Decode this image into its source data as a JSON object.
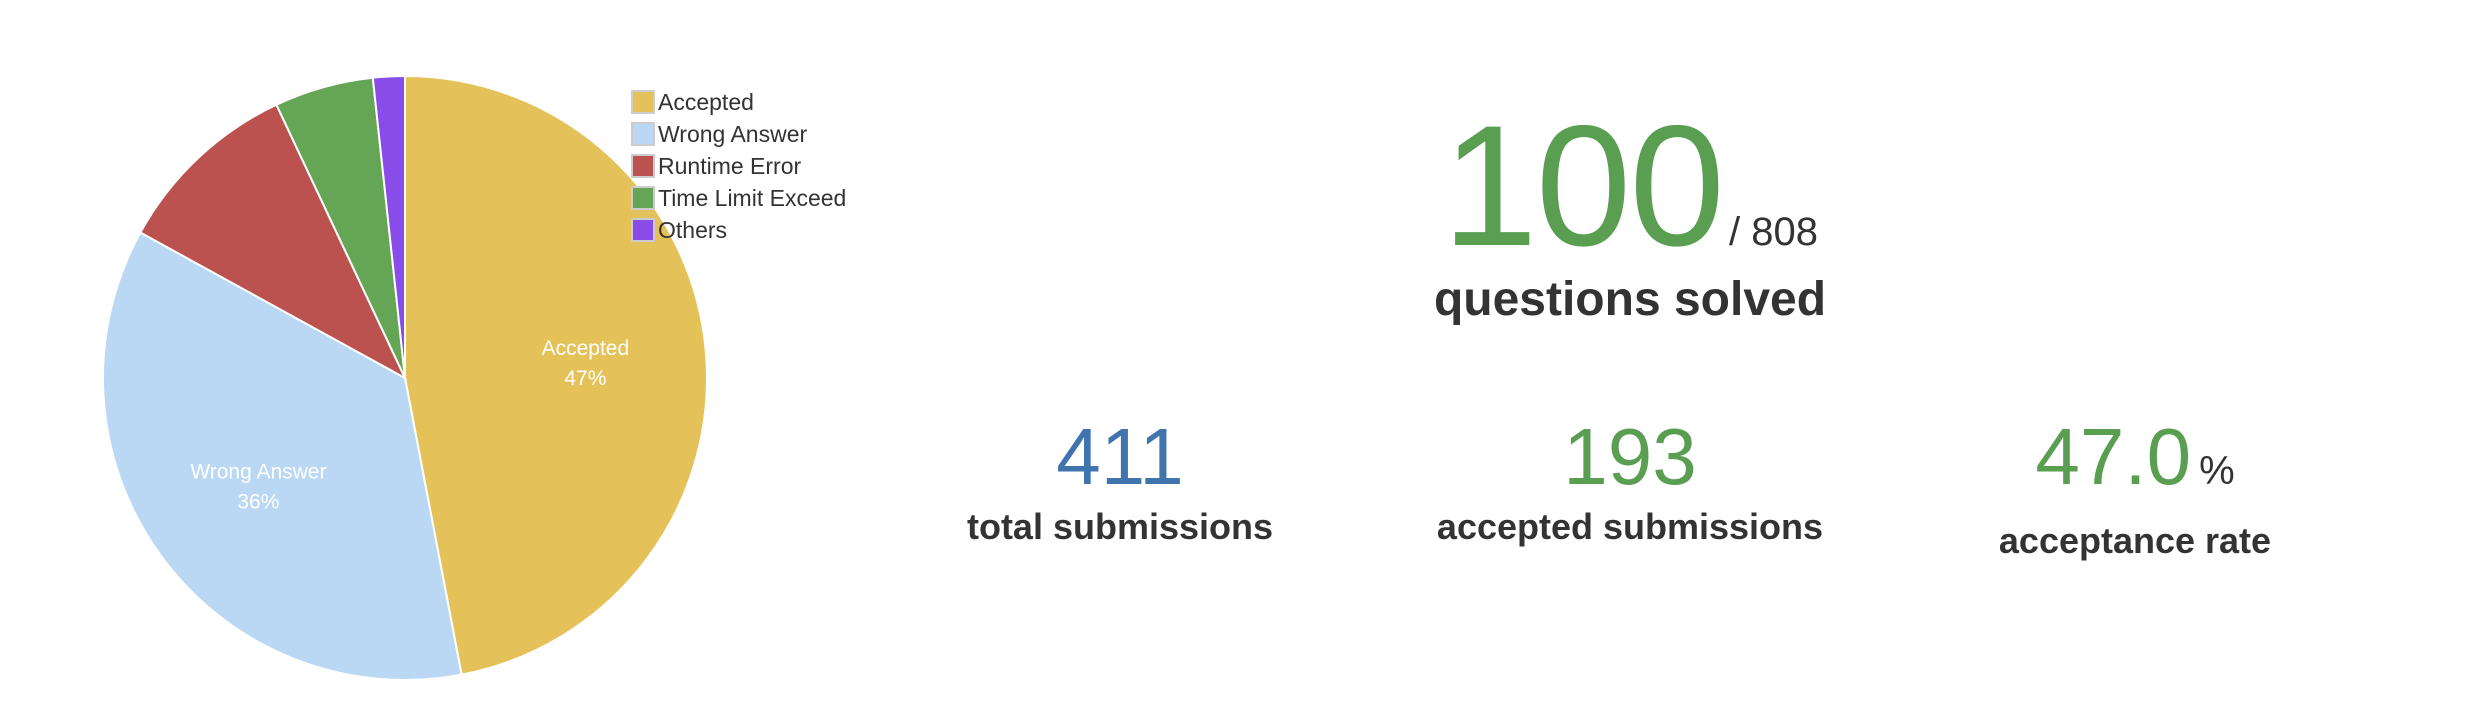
{
  "chart_data": {
    "type": "pie",
    "series": [
      {
        "name": "Accepted",
        "value": 47,
        "label": "47%",
        "color": "#e5c259"
      },
      {
        "name": "Wrong Answer",
        "value": 36,
        "label": "36%",
        "color": "#bad8f4"
      },
      {
        "name": "Runtime Error",
        "value": 10,
        "label": null,
        "color": "#bc5250"
      },
      {
        "name": "Time Limit Exceed",
        "value": 5.3,
        "label": null,
        "color": "#65a556"
      },
      {
        "name": "Others",
        "value": 1.7,
        "label": null,
        "color": "#8a4ce8"
      }
    ],
    "legend_position": "top-right"
  },
  "stats": {
    "solved": {
      "value": "100",
      "total": "/ 808",
      "caption": "questions solved",
      "color": "#5a9e52"
    },
    "total_submissions": {
      "value": "411",
      "caption": "total submissions",
      "color": "#3f74ad"
    },
    "accepted_submissions": {
      "value": "193",
      "caption": "accepted submissions",
      "color": "#5a9e52"
    },
    "acceptance_rate": {
      "value": "47.0",
      "unit": "%",
      "caption": "acceptance rate",
      "color": "#5a9e52"
    }
  }
}
